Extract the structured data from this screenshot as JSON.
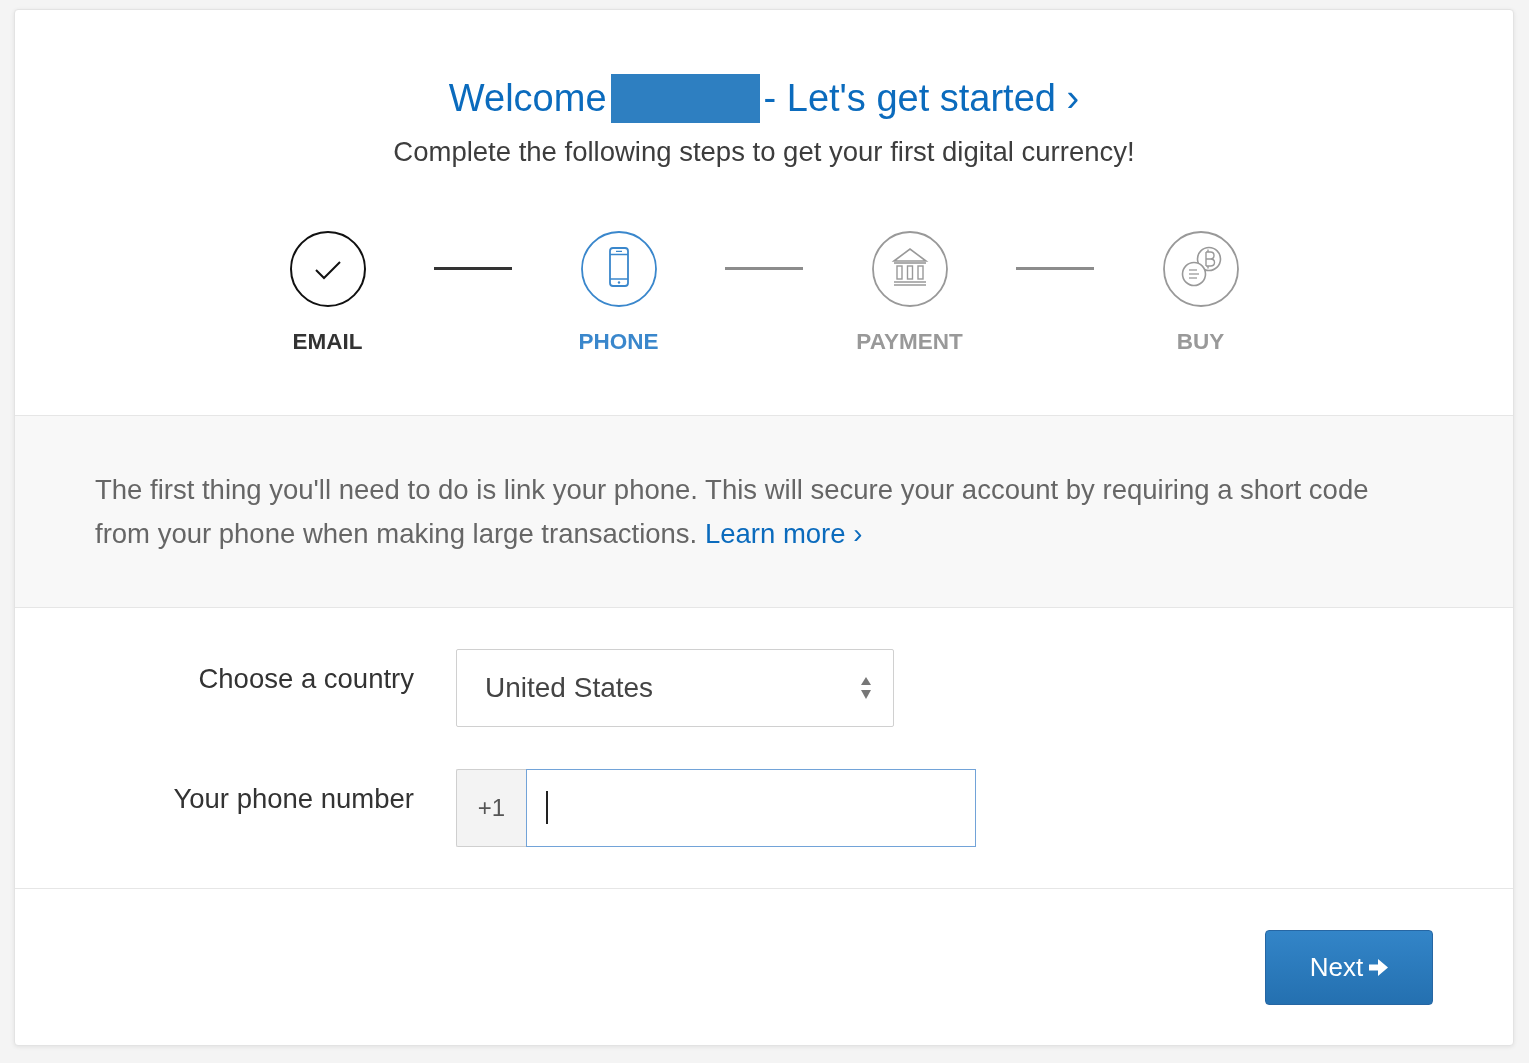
{
  "header": {
    "title_start": "Welcome",
    "title_redacted": true,
    "title_end": "- Let's get started ›",
    "subtitle": "Complete the following steps to get your first digital currency!"
  },
  "steps": [
    {
      "label": "EMAIL",
      "completed": true,
      "selected": false
    },
    {
      "label": "PHONE",
      "completed": false,
      "selected": true
    },
    {
      "label": "PAYMENT",
      "completed": false,
      "selected": false
    },
    {
      "label": "BUY",
      "completed": false,
      "selected": false
    }
  ],
  "intro": {
    "text": "The first thing you'll need to do is link your phone. This will secure your account by requiring a short code from your phone when making large transactions.",
    "link": "Learn more ›"
  },
  "form": {
    "fields": [
      {
        "kind": "select",
        "label": "Choose a country",
        "value": "United States"
      },
      {
        "kind": "phone",
        "label": "Your phone number",
        "prefix": "+1",
        "focused": true
      }
    ]
  },
  "buttons": [
    {
      "label": "Next"
    }
  ]
}
